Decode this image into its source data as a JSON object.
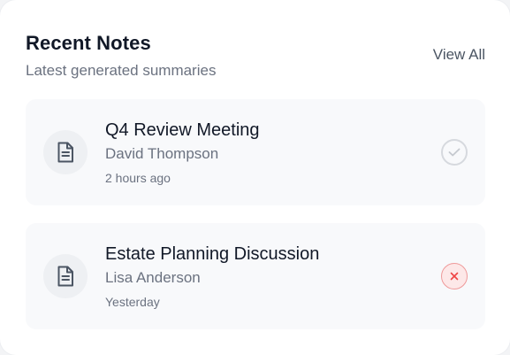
{
  "header": {
    "title": "Recent Notes",
    "subtitle": "Latest generated summaries",
    "view_all_label": "View All"
  },
  "notes": [
    {
      "title": "Q4 Review Meeting",
      "person": "David Thompson",
      "time": "2 hours ago",
      "status": "completed",
      "status_icon": "check-icon",
      "status_color": "#d1d5db"
    },
    {
      "title": "Estate Planning Discussion",
      "person": "Lisa Anderson",
      "time": "Yesterday",
      "status": "failed",
      "status_icon": "x-icon",
      "status_color": "#ef4444"
    }
  ],
  "icons": {
    "note_icon": "document-icon"
  },
  "colors": {
    "card_bg": "#ffffff",
    "item_bg": "#f8f9fb",
    "title_text": "#111827",
    "muted_text": "#6b7280",
    "error_accent": "#ef4444"
  }
}
